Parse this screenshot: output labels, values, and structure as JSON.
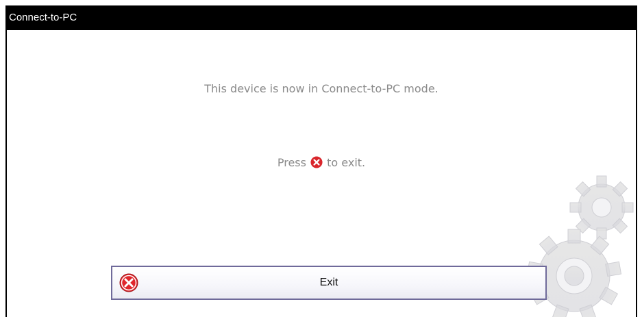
{
  "window": {
    "title": "Connect-to-PC"
  },
  "main": {
    "status_message": "This device is now in Connect-to-PC mode.",
    "instruction_prefix": "Press",
    "instruction_suffix": "to exit.",
    "instruction_icon": "close-circle-icon"
  },
  "exit_button": {
    "label": "Exit",
    "icon": "close-circle-icon"
  },
  "colors": {
    "title_bar_bg": "#000000",
    "title_bar_text": "#ffffff",
    "message_text": "#8a8a8a",
    "exit_icon_red": "#d9262c",
    "button_border": "#6f6a9a"
  },
  "decoration": {
    "background_art": "gears-watermark"
  }
}
